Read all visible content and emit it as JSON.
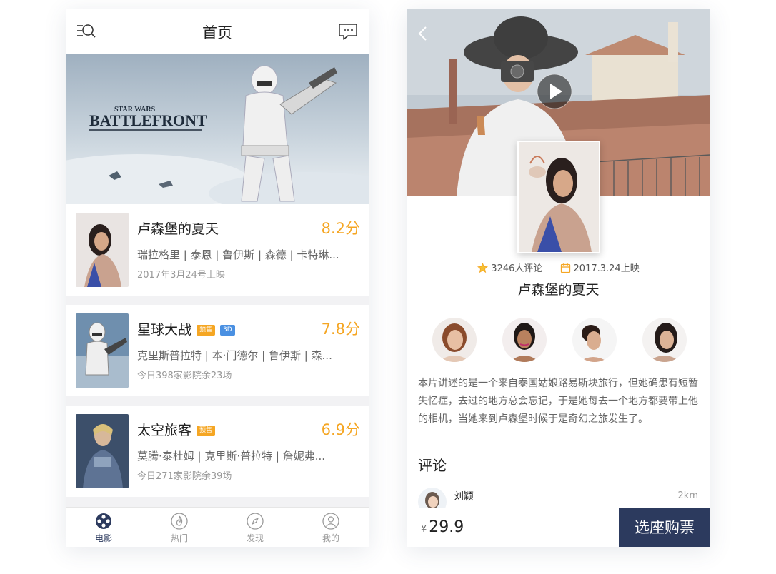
{
  "left": {
    "header": {
      "title": "首页"
    },
    "banner": {
      "title_small": "STAR WARS",
      "title_big": "BATTLEFRONT"
    },
    "movies": [
      {
        "name": "卢森堡的夏天",
        "score": "8.2分",
        "cast": "瑞拉格里 | 泰恩 | 鲁伊斯 | 森德 | 卡特琳...",
        "info": "2017年3月24号上映",
        "badges": []
      },
      {
        "name": "星球大战",
        "score": "7.8分",
        "cast": "克里斯普拉特 | 本·门德尔 | 鲁伊斯 | 森...",
        "info": "今日398家影院余23场",
        "badges": [
          "预售",
          "3D"
        ]
      },
      {
        "name": "太空旅客",
        "score": "6.9分",
        "cast": "莫腾·泰杜姆 | 克里斯·普拉特 | 詹妮弗...",
        "info": "今日271家影院余39场",
        "badges": [
          "预售"
        ]
      }
    ],
    "tabs": [
      {
        "label": "电影",
        "icon": "film-reel-icon",
        "active": true
      },
      {
        "label": "热门",
        "icon": "flame-icon",
        "active": false
      },
      {
        "label": "发现",
        "icon": "compass-icon",
        "active": false
      },
      {
        "label": "我的",
        "icon": "user-icon",
        "active": false
      }
    ]
  },
  "right": {
    "reviews": "3246人评论",
    "release": "2017.3.24上映",
    "title": "卢森堡的夏天",
    "synopsis": "本片讲述的是一个来自泰国姑娘路易斯块旅行，但她确患有短暂失忆症，去过的地方总会忘记，于是她每去一个地方都要带上他的相机，当她来到卢森堡时候于是奇幻之旅发生了。",
    "comments_title": "评论",
    "comment": {
      "user": "刘颖",
      "distance": "2km"
    },
    "price_currency": "¥",
    "price": "29.9",
    "buy_label": "选座购票"
  },
  "colors": {
    "accent": "#f5a623",
    "brand": "#2c3a5e",
    "badge_3d": "#4a90e2"
  }
}
